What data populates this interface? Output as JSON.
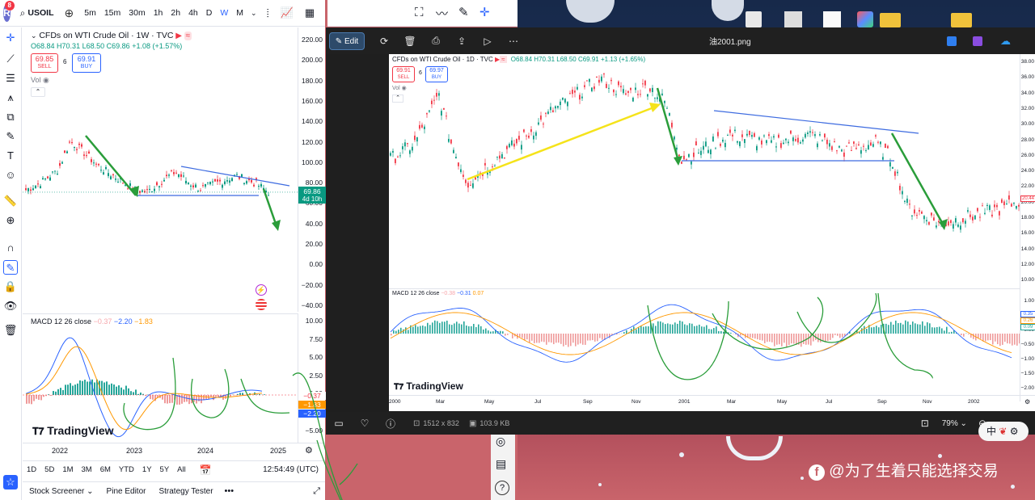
{
  "left_app": {
    "avatar_letter": "R",
    "avatar_badge": "8",
    "symbol": "USOIL",
    "intervals": [
      "5m",
      "15m",
      "30m",
      "1h",
      "2h",
      "4h",
      "D",
      "W",
      "M"
    ],
    "active_interval": "W",
    "chart_title": "CFDs on WTI Crude Oil · 1W · TVC",
    "ohlc": {
      "o": "O68.84",
      "h": "H70.31",
      "l": "L68.50",
      "c": "C69.86",
      "chg": "+1.08 (+1.57%)"
    },
    "sell": {
      "price": "69.85",
      "label": "SELL"
    },
    "spread": "6",
    "buy": {
      "price": "69.91",
      "label": "BUY"
    },
    "vol_label": "Vol",
    "price_labels": [
      "220.00",
      "200.00",
      "180.00",
      "160.00",
      "140.00",
      "120.00",
      "100.00",
      "80.00",
      "60.00",
      "40.00",
      "20.00",
      "0.00",
      "−20.00",
      "−40.00"
    ],
    "last_price": "69.86",
    "countdown": "4d 10h",
    "macd_label": "MACD 12 26 close",
    "macd_vals": [
      "−0.37",
      "−2.20",
      "−1.83"
    ],
    "macd_axis": [
      "10.00",
      "7.50",
      "5.00",
      "2.50",
      "0.00",
      "−2.50",
      "−5.00"
    ],
    "macd_tags": [
      "−0.37",
      "−1.83",
      "−2.20"
    ],
    "time_labels": [
      "2022",
      "2023",
      "2024",
      "2025"
    ],
    "logo": "TradingView",
    "ranges": [
      "1D",
      "5D",
      "1M",
      "3M",
      "6M",
      "YTD",
      "1Y",
      "5Y",
      "All"
    ],
    "clock": "12:54:49 (UTC)",
    "tabs": [
      "Stock Screener",
      "Pine Editor",
      "Strategy Tester"
    ]
  },
  "viewer": {
    "edit_label": "Edit",
    "filename": "油2001.png",
    "dimensions": "1512 x 832",
    "filesize": "103.9 KB",
    "zoom": "79%"
  },
  "inner": {
    "chart_title": "CFDs on WTI Crude Oil · 1D · TVC",
    "ohlc": "O68.84 H70.31 L68.50 C69.91 +1.13 (+1.65%)",
    "sell": {
      "price": "69.91",
      "label": "SELL"
    },
    "spread": "6",
    "buy": {
      "price": "69.97",
      "label": "BUY"
    },
    "vol_label": "Vol",
    "price_labels": [
      "38.00",
      "36.00",
      "34.00",
      "32.00",
      "30.00",
      "28.00",
      "26.00",
      "24.00",
      "22.00",
      "20.00",
      "18.00",
      "16.00",
      "14.00",
      "12.00",
      "10.00"
    ],
    "last_tag": "20.44",
    "macd_label": "MACD 12 26 close",
    "macd_vals": [
      "−0.38",
      "−0.31",
      "0.07"
    ],
    "macd_axis": [
      "1.00",
      "0.50",
      "0.00",
      "−0.50",
      "−1.00",
      "−1.50",
      "−2.00"
    ],
    "macd_tags": [
      "0.35",
      "0.26",
      "0.09"
    ],
    "time_labels": [
      "2000",
      "Mar",
      "May",
      "Jul",
      "Sep",
      "Nov",
      "2001",
      "Mar",
      "May",
      "Jul",
      "Sep",
      "Nov",
      "2002"
    ],
    "logo": "TradingView"
  },
  "desktop": {
    "ime": "中",
    "watermark": "@为了生着只能选择交易"
  },
  "colors": {
    "accent": "#2962ff",
    "up": "#089981",
    "down": "#f23645",
    "trend": "#2a9d3a",
    "line": "#3d6be0",
    "yellow": "#f5e31a"
  }
}
